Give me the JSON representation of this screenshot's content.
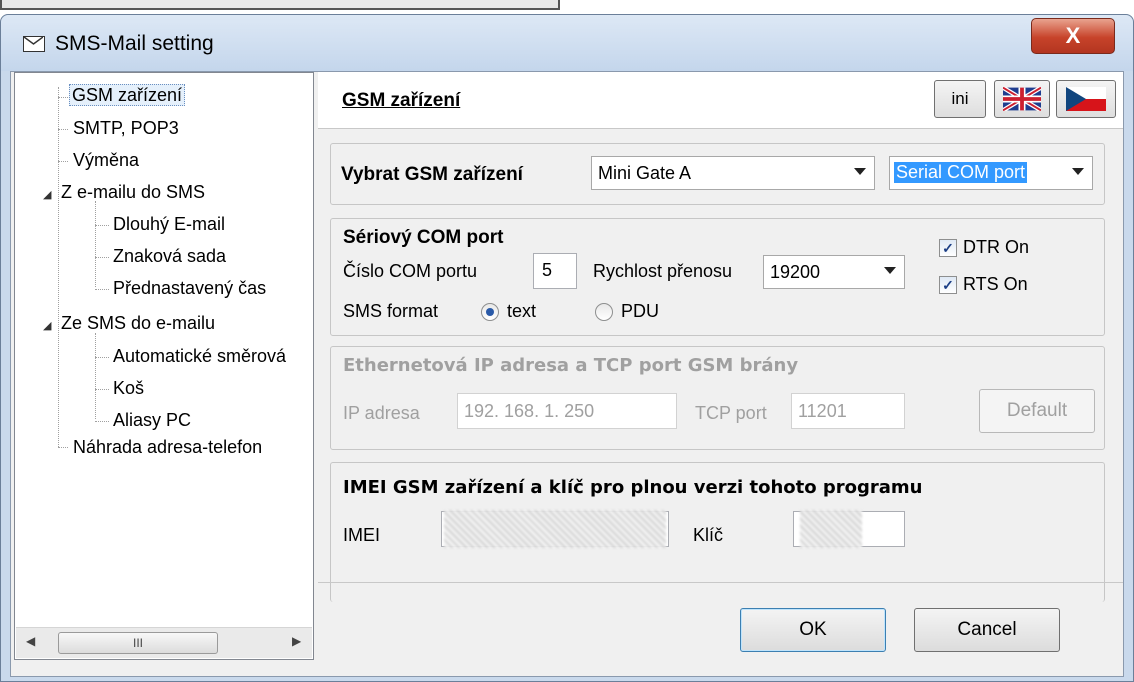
{
  "window": {
    "title": "SMS-Mail setting",
    "close_label": "X"
  },
  "tree": {
    "items": [
      {
        "label": "GSM zařízení",
        "level": 1,
        "selected": true
      },
      {
        "label": "SMTP, POP3",
        "level": 1
      },
      {
        "label": "Výměna",
        "level": 1
      },
      {
        "label": "Z e-mailu do SMS",
        "level": 0,
        "expanded": true
      },
      {
        "label": "Dlouhý E-mail",
        "level": 2
      },
      {
        "label": "Znaková sada",
        "level": 2
      },
      {
        "label": "Přednastavený čas",
        "level": 2
      },
      {
        "label": "Ze SMS do e-mailu",
        "level": 0,
        "expanded": true
      },
      {
        "label": "Automatické směrová",
        "level": 2
      },
      {
        "label": "Koš",
        "level": 2
      },
      {
        "label": "Aliasy PC",
        "level": 2
      },
      {
        "label": "Náhrada adresa-telefon",
        "level": 1
      }
    ],
    "expander_glyph": "◢",
    "scroll_left": "◀",
    "scroll_right": "▶",
    "scroll_thumb": "III"
  },
  "header": {
    "title": "GSM zařízení",
    "ini_label": "ini",
    "flag_uk": "uk-flag-icon",
    "flag_cz": "cz-flag-icon"
  },
  "device": {
    "label": "Vybrat GSM zařízení",
    "device_value": "Mini Gate A",
    "connection_value": "Serial COM port"
  },
  "serial": {
    "heading": "Sériový COM port",
    "com_label": "Číslo COM portu",
    "com_value": "5",
    "speed_label": "Rychlost přenosu",
    "speed_value": "19200",
    "dtr_label": "DTR On",
    "dtr_checked": true,
    "rts_label": "RTS On",
    "rts_checked": true,
    "format_label": "SMS format",
    "format_text": "text",
    "format_pdu": "PDU",
    "format_selected": "text",
    "check_glyph": "✓"
  },
  "ethernet": {
    "heading": "Ethernetová IP adresa a TCP port GSM brány",
    "ip_label": "IP adresa",
    "ip_value": "192. 168. 1. 250",
    "tcp_label": "TCP port",
    "tcp_value": "11201",
    "default_label": "Default"
  },
  "imei": {
    "heading": "IMEI GSM zařízení a klíč pro plnou verzi tohoto programu",
    "imei_label": "IMEI",
    "key_label": "Klíč"
  },
  "buttons": {
    "ok": "OK",
    "cancel": "Cancel"
  },
  "colors": {
    "selection_bg": "#3399ff",
    "close_red": "#c7432a",
    "titlebar": "#c9d9ec"
  }
}
